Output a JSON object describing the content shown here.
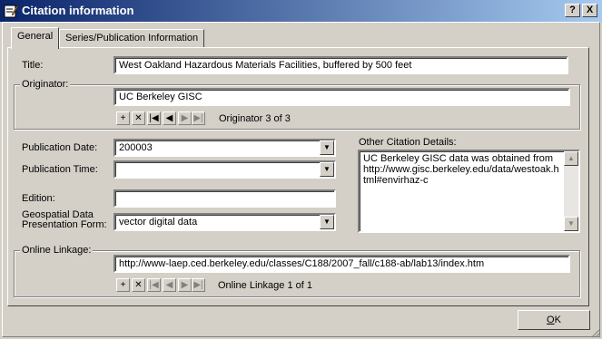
{
  "window": {
    "title": "Citation information",
    "help_label": "?",
    "close_label": "X"
  },
  "tabs": [
    {
      "label": "General",
      "active": true
    },
    {
      "label": "Series/Publication Information",
      "active": false
    }
  ],
  "general": {
    "title_label": "Title:",
    "title_value": "West Oakland Hazardous Materials Facilities, buffered by 500 feet",
    "originator_group": "Originator:",
    "originator_value": "UC Berkeley GISC",
    "originator_nav": {
      "add": "+",
      "delete": "✕",
      "first": "|◀",
      "prev": "◀",
      "next": "▶",
      "last": "▶|",
      "status": "Originator 3 of 3"
    },
    "pub_date_label": "Publication Date:",
    "pub_date_value": "200003",
    "pub_time_label": "Publication Time:",
    "pub_time_value": "",
    "edition_label": "Edition:",
    "edition_value": "",
    "geo_form_label_1": "Geospatial Data",
    "geo_form_label_2": "Presentation Form:",
    "geo_form_value": "vector digital data",
    "other_details_label": "Other Citation Details:",
    "other_details_lines": [
      "UC Berkeley GISC data was obtained from",
      "http://www.gisc.berkeley.edu/data/westoak.h",
      "tml#envirhaz-c"
    ],
    "online_group": "Online Linkage:",
    "online_value": "http://www-laep.ced.berkeley.edu/classes/C188/2007_fall/c188-ab/lab13/index.htm",
    "online_nav": {
      "add": "+",
      "delete": "✕",
      "first": "|◀",
      "prev": "◀",
      "next": "▶",
      "last": "▶|",
      "status": "Online Linkage 1 of 1"
    }
  },
  "footer": {
    "ok_label_u": "O",
    "ok_label_rest": "K"
  }
}
